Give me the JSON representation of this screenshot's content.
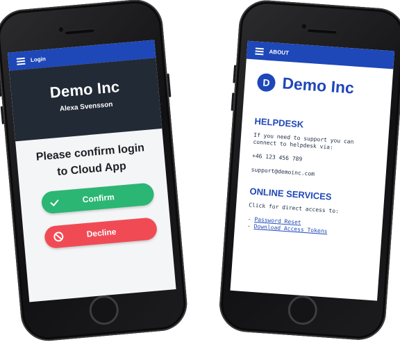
{
  "left_phone": {
    "topbar": {
      "menu_icon": "hamburger-menu-icon",
      "title": "Login"
    },
    "company": "Demo Inc",
    "user": "Alexa Svensson",
    "prompt_line1": "Please confirm login",
    "prompt_line2": "to Cloud App",
    "confirm": {
      "label": "Confirm",
      "icon": "check-icon",
      "color": "#2bb673"
    },
    "decline": {
      "label": "Decline",
      "icon": "ban-icon",
      "color": "#f04b55"
    }
  },
  "right_phone": {
    "topbar": {
      "menu_icon": "hamburger-menu-icon",
      "title": "ABOUT"
    },
    "logo_letter": "D",
    "company": "Demo Inc",
    "helpdesk": {
      "heading": "HELPDESK",
      "line1": "If you need to support you can",
      "line2": "connect to helpdesk via:",
      "phone": "+46 123 456 789",
      "email": "support@demoinc.com"
    },
    "online_services": {
      "heading": "ONLINE SERVICES",
      "intro": "Click for direct access to:",
      "links": [
        {
          "prefix": "- ",
          "label": "Password Reset"
        },
        {
          "prefix": "- ",
          "label": "Download Access Tokens"
        }
      ]
    }
  },
  "colors": {
    "accent": "#1e47b8",
    "hero_bg": "#222a36"
  }
}
